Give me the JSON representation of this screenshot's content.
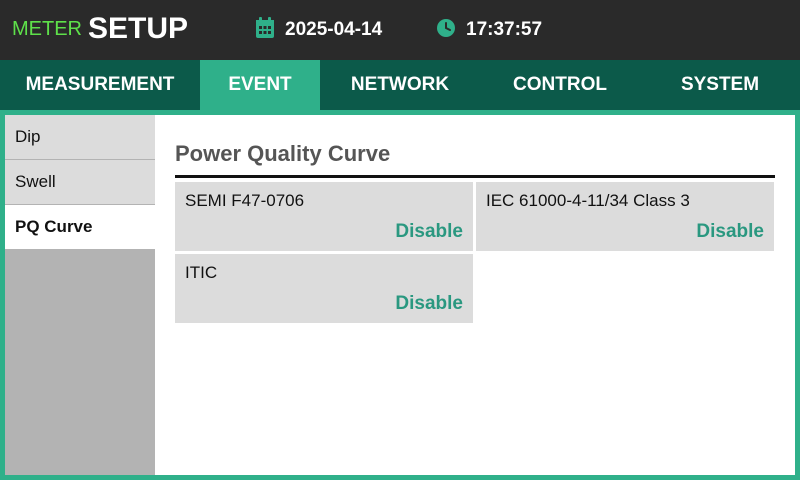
{
  "header": {
    "meter_label": "METER",
    "setup_label": "SETUP",
    "date": "2025-04-14",
    "time": "17:37:57",
    "calendar_icon": "calendar-icon",
    "clock_icon": "clock-icon"
  },
  "tabs": [
    {
      "label": "MEASUREMENT"
    },
    {
      "label": "EVENT",
      "active": true
    },
    {
      "label": "NETWORK"
    },
    {
      "label": "CONTROL"
    },
    {
      "label": "SYSTEM"
    }
  ],
  "sidebar": {
    "items": [
      {
        "label": "Dip"
      },
      {
        "label": "Swell"
      },
      {
        "label": "PQ Curve",
        "active": true
      }
    ]
  },
  "main": {
    "title": "Power Quality Curve",
    "cards": [
      {
        "label": "SEMI F47-0706",
        "value": "Disable"
      },
      {
        "label": "IEC 61000-4-11/34 Class 3",
        "value": "Disable"
      },
      {
        "label": "ITIC",
        "value": "Disable"
      }
    ]
  },
  "colors": {
    "header_bg": "#2a2a2a",
    "tab_bar_bg": "#0c5a4a",
    "accent": "#2fb08a",
    "meter_green": "#5ee04a",
    "value_green": "#2a9880"
  }
}
